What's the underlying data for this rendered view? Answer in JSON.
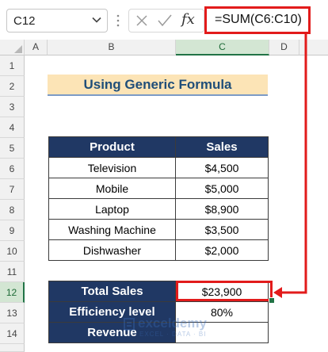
{
  "formula_bar": {
    "name_box": "C12",
    "fx_label": "fx",
    "formula": "=SUM(C6:C10)"
  },
  "columns": [
    "A",
    "B",
    "C",
    "D"
  ],
  "rows": [
    "1",
    "2",
    "3",
    "4",
    "5",
    "6",
    "7",
    "8",
    "9",
    "10",
    "11",
    "12",
    "13",
    "14"
  ],
  "title": "Using Generic Formula",
  "table": {
    "headers": [
      "Product",
      "Sales"
    ],
    "rows": [
      {
        "product": "Television",
        "sales": "$4,500"
      },
      {
        "product": "Mobile",
        "sales": "$5,000"
      },
      {
        "product": "Laptop",
        "sales": "$8,900"
      },
      {
        "product": "Washing Machine",
        "sales": "$3,500"
      },
      {
        "product": "Dishwasher",
        "sales": "$2,000"
      }
    ]
  },
  "summary": [
    {
      "label": "Total Sales",
      "value": "$23,900"
    },
    {
      "label": "Efficiency level",
      "value": "80%"
    },
    {
      "label": "Revenue",
      "value": ""
    }
  ],
  "watermark": {
    "name": "exceldemy",
    "tag": "EXCEL · DATA · BI"
  },
  "colors": {
    "header_fill": "#203864",
    "title_fill": "#fce4b6",
    "highlight": "#e21b1b",
    "excel_green": "#217346"
  }
}
